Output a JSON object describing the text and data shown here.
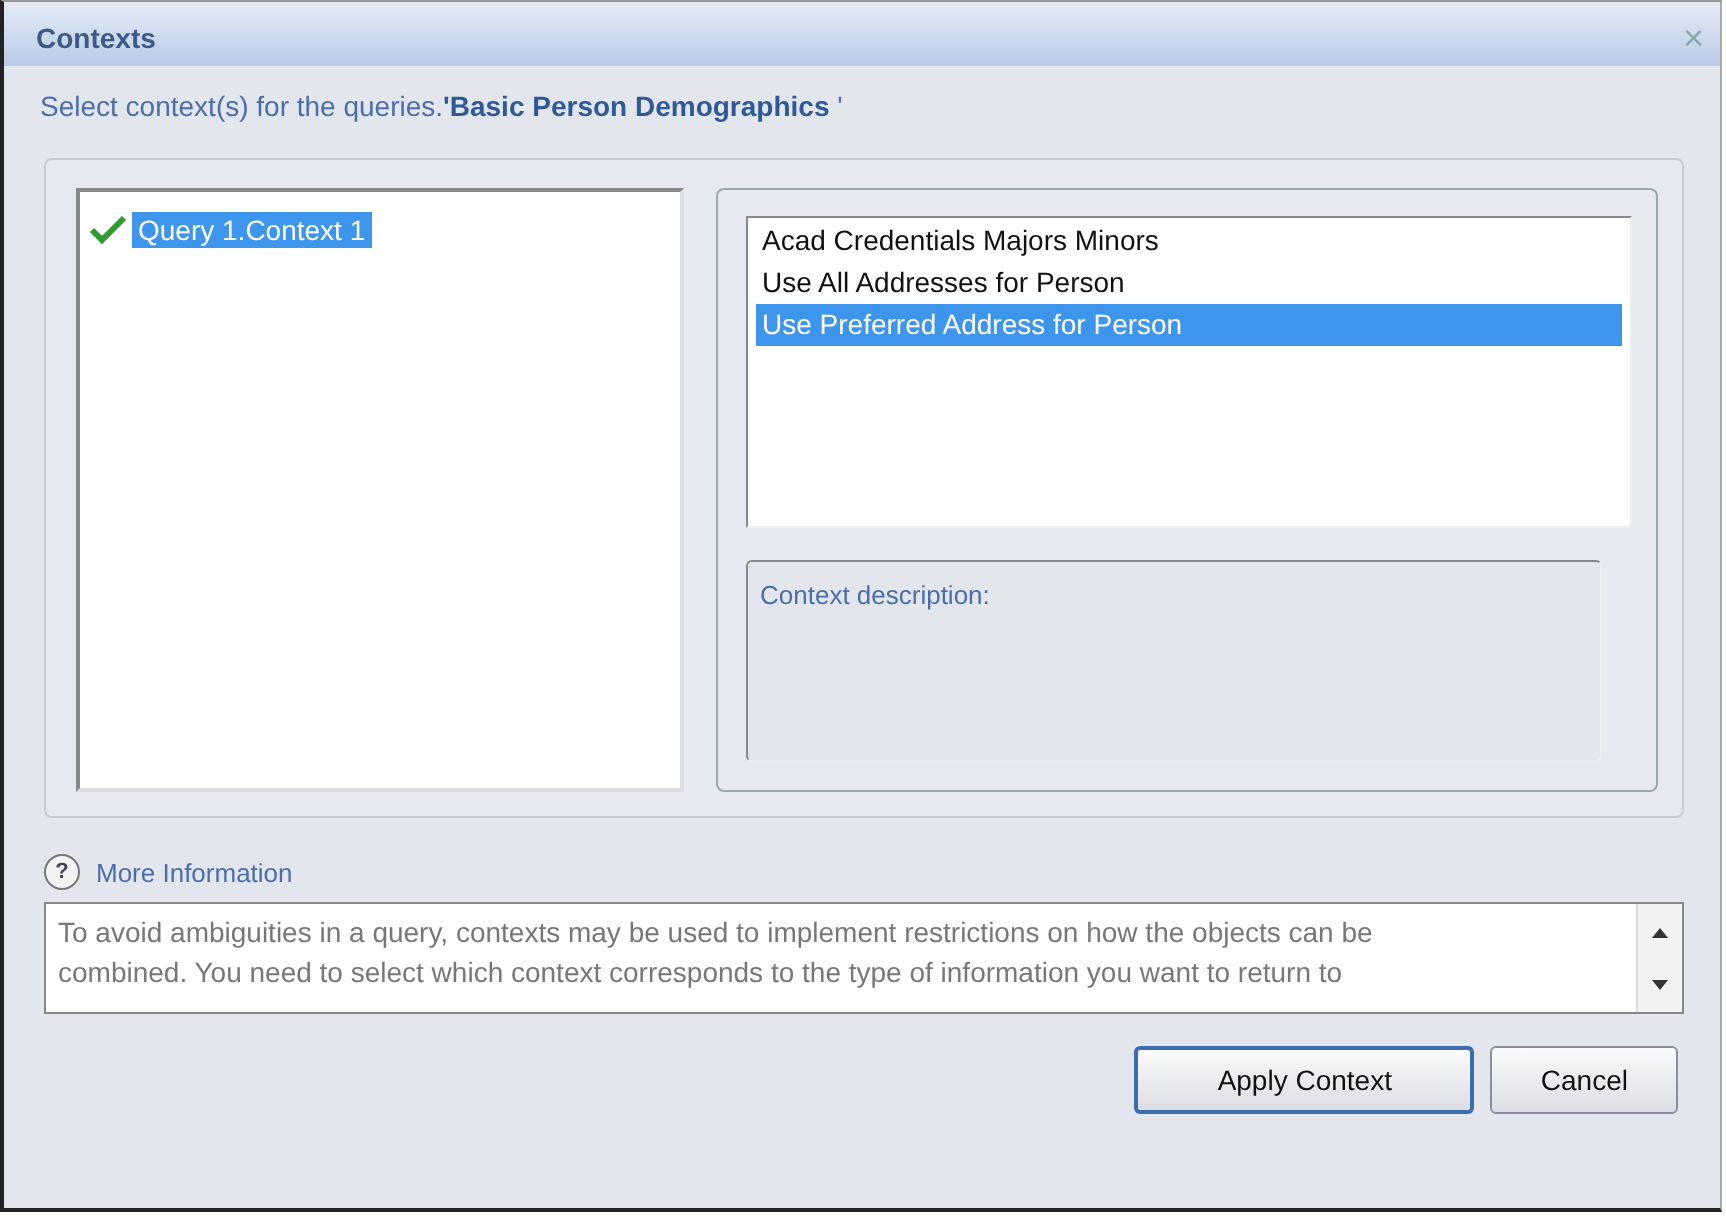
{
  "window": {
    "title": "Contexts",
    "close": "×"
  },
  "instruction": "Select context(s) for the queries.**'Basic Person Demographics** '",
  "queries": [
    {
      "label": "Query 1.Context 1",
      "checked": true,
      "selected": true
    }
  ],
  "contexts": [
    {
      "label": "Acad Credentials Majors Minors",
      "selected": false
    },
    {
      "label": "Use All Addresses for Person",
      "selected": false
    },
    {
      "label": "Use Preferred Address for Person",
      "selected": true
    }
  ],
  "description": {
    "label": "Context description:"
  },
  "more_info": {
    "icon": "?",
    "label": "More Information",
    "text": "To avoid ambiguities in a query, contexts may be used to implement restrictions on how the objects can be combined. You need to select which context corresponds to the type of information you want to return to"
  },
  "buttons": [
    {
      "label": "Apply Context",
      "default": true
    },
    {
      "label": "Cancel",
      "default": false
    }
  ]
}
